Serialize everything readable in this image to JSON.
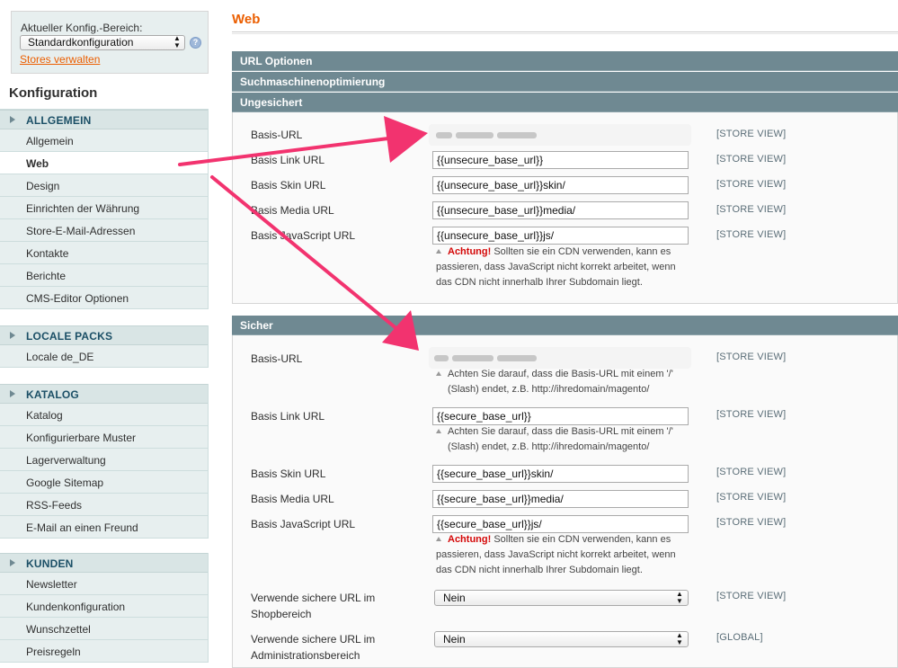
{
  "sidebar": {
    "scope_label": "Aktueller Konfig.-Bereich:",
    "scope_value": "Standardkonfiguration",
    "stores_link": "Stores verwalten",
    "title": "Konfiguration",
    "groups": [
      {
        "header": "ALLGEMEIN",
        "items": [
          "Allgemein",
          "Web",
          "Design",
          "Einrichten der Währung",
          "Store-E-Mail-Adressen",
          "Kontakte",
          "Berichte",
          "CMS-Editor Optionen"
        ]
      },
      {
        "header": "LOCALE PACKS",
        "items": [
          "Locale de_DE"
        ]
      },
      {
        "header": "KATALOG",
        "items": [
          "Katalog",
          "Konfigurierbare Muster",
          "Lagerverwaltung",
          "Google Sitemap",
          "RSS-Feeds",
          "E-Mail an einen Freund"
        ]
      },
      {
        "header": "KUNDEN",
        "items": [
          "Newsletter",
          "Kundenkonfiguration",
          "Wunschzettel",
          "Preisregeln"
        ]
      }
    ],
    "active_item": "Web"
  },
  "main": {
    "title": "Web",
    "sections": [
      "URL Optionen",
      "Suchmaschinenoptimierung",
      "Ungesichert",
      "Sicher"
    ],
    "unsecure": {
      "base_url_label": "Basis-URL",
      "link_url_label": "Basis Link URL",
      "link_url_value": "{{unsecure_base_url}}",
      "skin_url_label": "Basis Skin URL",
      "skin_url_value": "{{unsecure_base_url}}skin/",
      "media_url_label": "Basis Media URL",
      "media_url_value": "{{unsecure_base_url}}media/",
      "js_url_label": "Basis JavaScript URL",
      "js_url_value": "{{unsecure_base_url}}js/",
      "js_warning_bold": "Achtung!",
      "js_warning_line1": " Sollten sie ein CDN verwenden, kann es",
      "js_warning_line2": "passieren, dass JavaScript nicht korrekt arbeitet, wenn",
      "js_warning_line3": "das CDN nicht innerhalb Ihrer Subdomain liegt."
    },
    "secure": {
      "base_url_label": "Basis-URL",
      "base_url_note_line1": "Achten Sie darauf, dass die Basis-URL mit einem '/'",
      "base_url_note_line2": "(Slash) endet, z.B. http://ihredomain/magento/",
      "link_url_label": "Basis Link URL",
      "link_url_value": "{{secure_base_url}}",
      "link_url_note_line1": "Achten Sie darauf, dass die Basis-URL mit einem '/'",
      "link_url_note_line2": "(Slash) endet, z.B. http://ihredomain/magento/",
      "skin_url_label": "Basis Skin URL",
      "skin_url_value": "{{secure_base_url}}skin/",
      "media_url_label": "Basis Media URL",
      "media_url_value": "{{secure_base_url}}media/",
      "js_url_label": "Basis JavaScript URL",
      "js_url_value": "{{secure_base_url}}js/",
      "js_warning_bold": "Achtung!",
      "js_warning_line1": " Sollten sie ein CDN verwenden, kann es",
      "js_warning_line2": "passieren, dass JavaScript nicht korrekt arbeitet, wenn",
      "js_warning_line3": "das CDN nicht innerhalb Ihrer Subdomain liegt.",
      "frontend_label_line1": "Verwende sichere URL im",
      "frontend_label_line2": "Shopbereich",
      "frontend_value": "Nein",
      "admin_label_line1": "Verwende sichere URL im",
      "admin_label_line2": "Administrationsbereich",
      "admin_value": "Nein"
    },
    "scope_store_view": "[STORE VIEW]",
    "scope_global": "[GLOBAL]"
  },
  "colors": {
    "accent": "#eb5e00",
    "section_bar": "#6f8992",
    "sidebar_bg": "#e7efef",
    "annotation_arrow": "#f2336f",
    "warning_red": "#d40707"
  }
}
